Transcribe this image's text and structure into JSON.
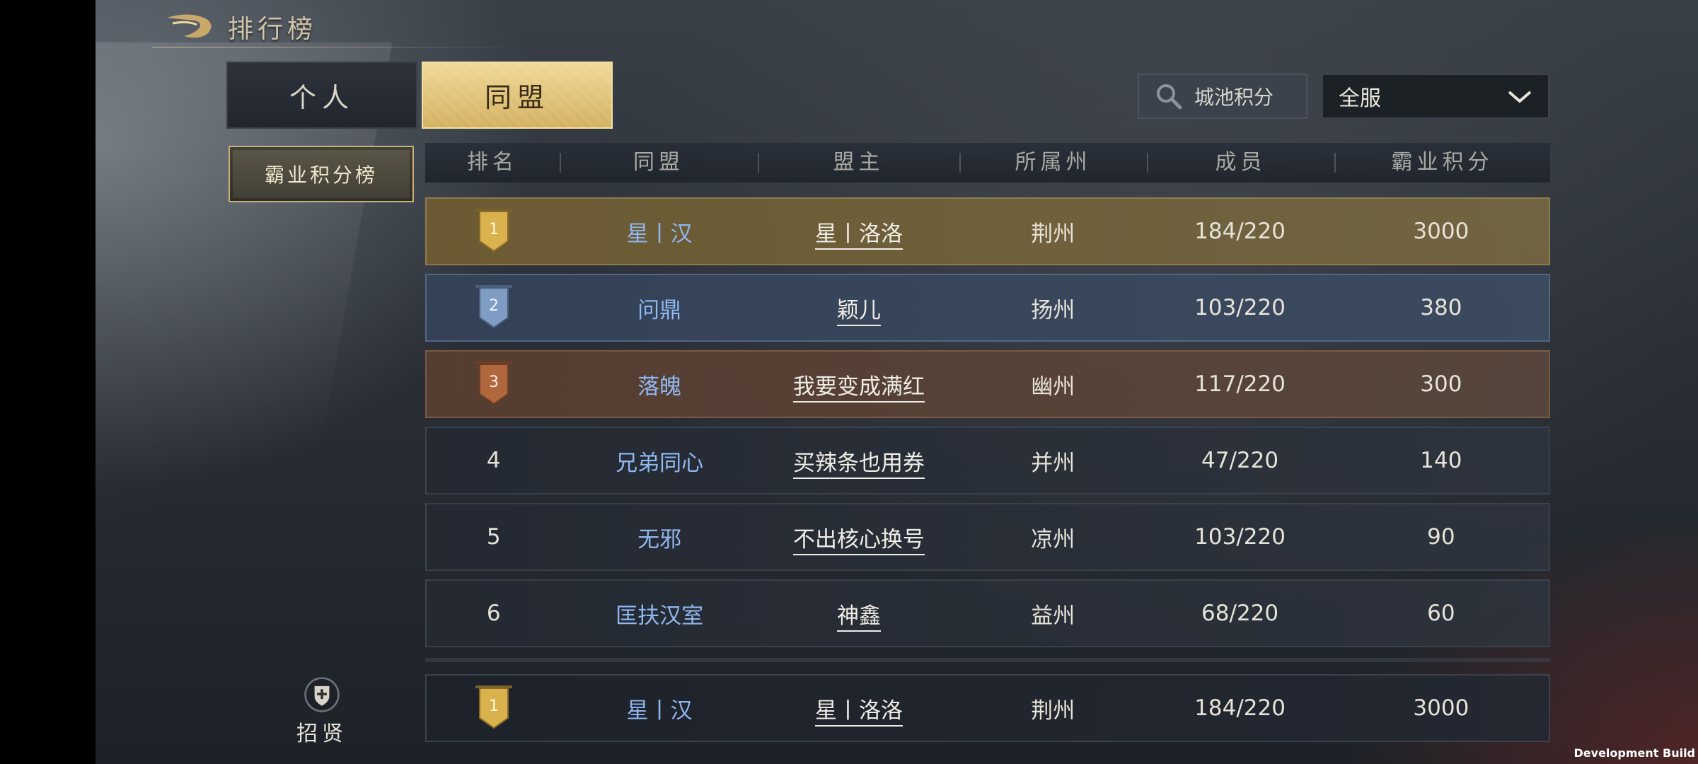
{
  "header": {
    "title": "排行榜"
  },
  "tabs": [
    {
      "label": "个人",
      "active": false
    },
    {
      "label": "同盟",
      "active": true
    }
  ],
  "search": {
    "label": "城池积分"
  },
  "server_select": {
    "value": "全服"
  },
  "side_category": {
    "label": "霸业积分榜"
  },
  "table": {
    "columns": [
      "排名",
      "同盟",
      "盟主",
      "所属州",
      "成员",
      "霸业积分"
    ],
    "rows": [
      {
        "rank": "1",
        "alliance": "星丨汉",
        "leader": "星丨洛洛",
        "state": "荆州",
        "members": "184/220",
        "score": "3000"
      },
      {
        "rank": "2",
        "alliance": "问鼎",
        "leader": "颖儿",
        "state": "扬州",
        "members": "103/220",
        "score": "380"
      },
      {
        "rank": "3",
        "alliance": "落魄",
        "leader": "我要变成满红",
        "state": "幽州",
        "members": "117/220",
        "score": "300"
      },
      {
        "rank": "4",
        "alliance": "兄弟同心",
        "leader": "买辣条也用券",
        "state": "并州",
        "members": "47/220",
        "score": "140"
      },
      {
        "rank": "5",
        "alliance": "无邪",
        "leader": "不出核心换号",
        "state": "凉州",
        "members": "103/220",
        "score": "90"
      },
      {
        "rank": "6",
        "alliance": "匡扶汉室",
        "leader": "神鑫",
        "state": "益州",
        "members": "68/220",
        "score": "60"
      }
    ]
  },
  "self_row": {
    "rank": "1",
    "alliance": "星丨汉",
    "leader": "星丨洛洛",
    "state": "荆州",
    "members": "184/220",
    "score": "3000"
  },
  "recruit": {
    "label": "招贤"
  },
  "watermark": "Development Build",
  "colors": {
    "gold_tab": "#e2c47a",
    "alliance_text": "#8fb7f0",
    "gold_medal": "#d9b24e",
    "silver_medal": "#7f9cc4",
    "bronze_medal": "#b0673e"
  }
}
